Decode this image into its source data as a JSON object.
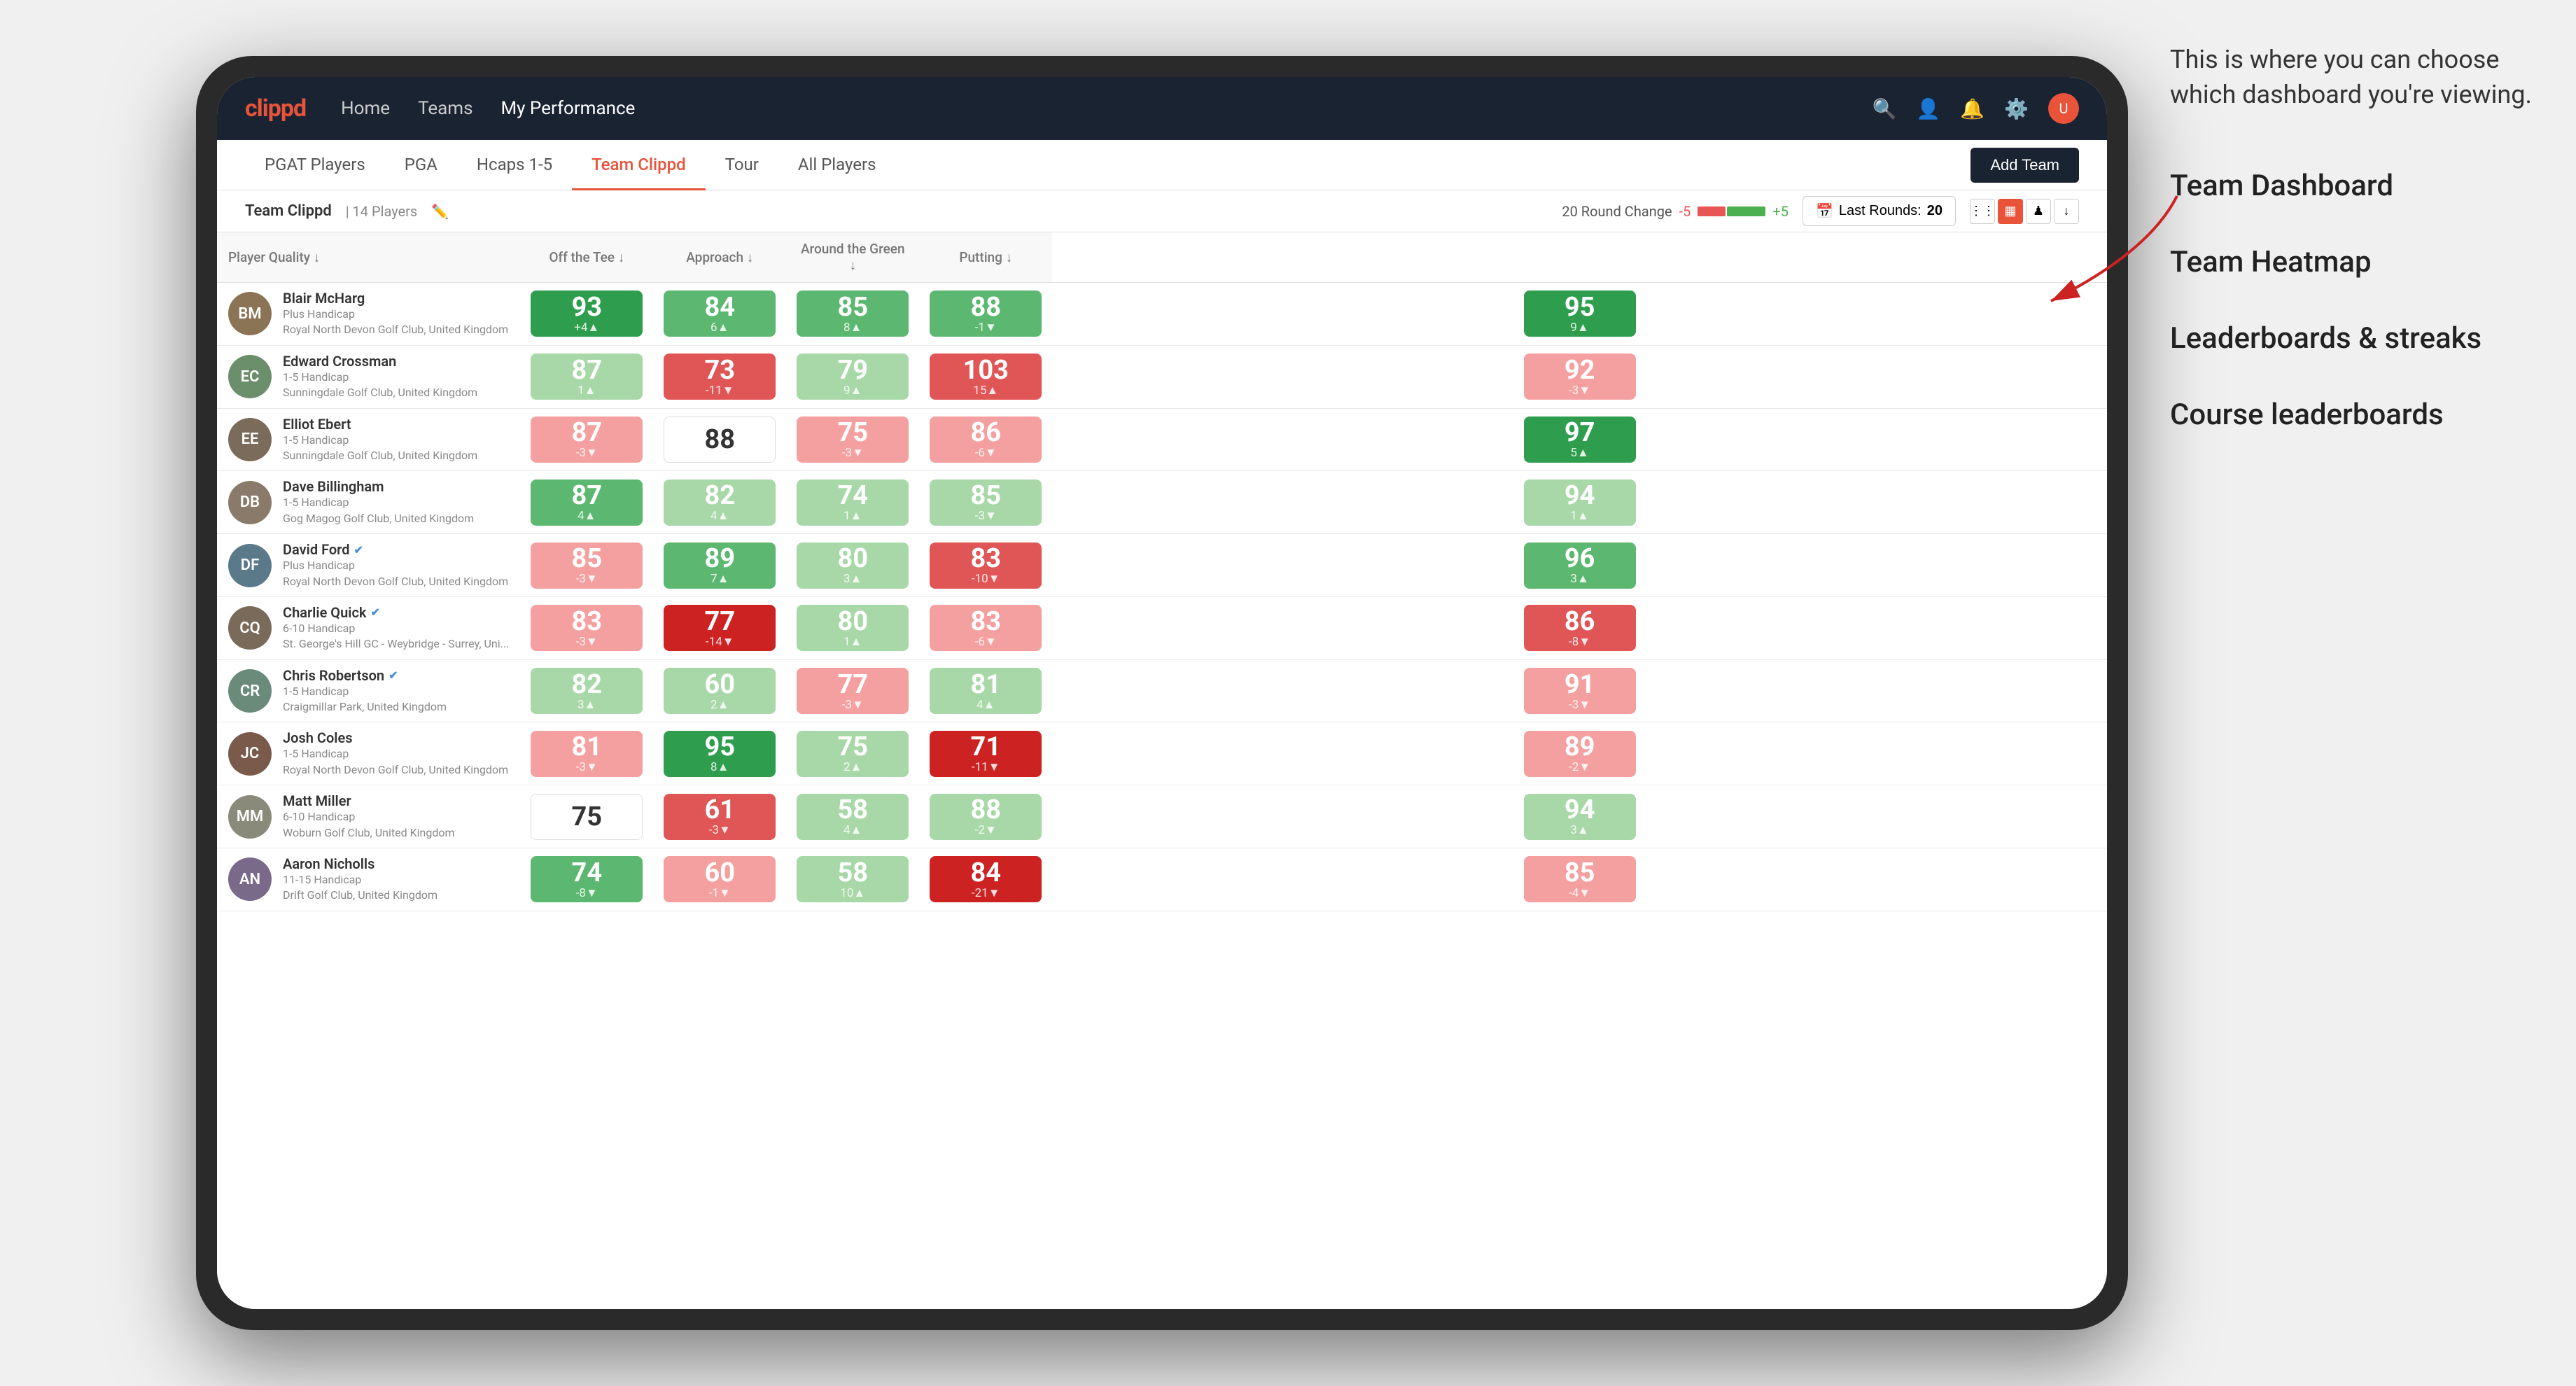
{
  "annotation": {
    "callout": "This is where you can choose which dashboard you're viewing.",
    "items": [
      "Team Dashboard",
      "Team Heatmap",
      "Leaderboards & streaks",
      "Course leaderboards"
    ]
  },
  "nav": {
    "logo": "clippd",
    "items": [
      "Home",
      "Teams",
      "My Performance"
    ],
    "active_item": "My Performance"
  },
  "tabs": {
    "items": [
      "PGAT Players",
      "PGA",
      "Hcaps 1-5",
      "Team Clippd",
      "Tour",
      "All Players"
    ],
    "active": "Team Clippd",
    "add_team_label": "Add Team"
  },
  "sub_header": {
    "team_name": "Team Clippd",
    "separator": "|",
    "player_count": "14 Players",
    "round_change_label": "20 Round Change",
    "change_neg": "-5",
    "change_pos": "+5",
    "last_rounds_label": "Last Rounds:",
    "last_rounds_value": "20"
  },
  "table": {
    "columns": [
      "Player Quality ↓",
      "Off the Tee ↓",
      "Approach ↓",
      "Around the Green ↓",
      "Putting ↓"
    ],
    "rows": [
      {
        "name": "Blair McHarg",
        "handicap": "Plus Handicap",
        "club": "Royal North Devon Golf Club, United Kingdom",
        "initials": "BM",
        "avatar_color": "#8B7355",
        "scores": [
          {
            "value": 93,
            "delta": "+4",
            "dir": "up",
            "bg": "green-dark"
          },
          {
            "value": 84,
            "delta": "6",
            "dir": "up",
            "bg": "green-mid"
          },
          {
            "value": 85,
            "delta": "8",
            "dir": "up",
            "bg": "green-mid"
          },
          {
            "value": 88,
            "delta": "-1",
            "dir": "down",
            "bg": "green-mid"
          },
          {
            "value": 95,
            "delta": "9",
            "dir": "up",
            "bg": "green-dark"
          }
        ]
      },
      {
        "name": "Edward Crossman",
        "handicap": "1-5 Handicap",
        "club": "Sunningdale Golf Club, United Kingdom",
        "initials": "EC",
        "avatar_color": "#6B8E6B",
        "scores": [
          {
            "value": 87,
            "delta": "1",
            "dir": "up",
            "bg": "green-light"
          },
          {
            "value": 73,
            "delta": "-11",
            "dir": "down",
            "bg": "red-mid"
          },
          {
            "value": 79,
            "delta": "9",
            "dir": "up",
            "bg": "green-light"
          },
          {
            "value": 103,
            "delta": "15",
            "dir": "up",
            "bg": "red-mid"
          },
          {
            "value": 92,
            "delta": "-3",
            "dir": "down",
            "bg": "red-light"
          }
        ]
      },
      {
        "name": "Elliot Ebert",
        "handicap": "1-5 Handicap",
        "club": "Sunningdale Golf Club, United Kingdom",
        "initials": "EE",
        "avatar_color": "#7B6B5A",
        "scores": [
          {
            "value": 87,
            "delta": "-3",
            "dir": "down",
            "bg": "red-light"
          },
          {
            "value": 88,
            "delta": "",
            "dir": "none",
            "bg": "white"
          },
          {
            "value": 75,
            "delta": "-3",
            "dir": "down",
            "bg": "red-light"
          },
          {
            "value": 86,
            "delta": "-6",
            "dir": "down",
            "bg": "red-light"
          },
          {
            "value": 97,
            "delta": "5",
            "dir": "up",
            "bg": "green-dark"
          }
        ]
      },
      {
        "name": "Dave Billingham",
        "handicap": "1-5 Handicap",
        "club": "Gog Magog Golf Club, United Kingdom",
        "initials": "DB",
        "avatar_color": "#8A7A6A",
        "scores": [
          {
            "value": 87,
            "delta": "4",
            "dir": "up",
            "bg": "green-mid"
          },
          {
            "value": 82,
            "delta": "4",
            "dir": "up",
            "bg": "green-light"
          },
          {
            "value": 74,
            "delta": "1",
            "dir": "up",
            "bg": "green-light"
          },
          {
            "value": 85,
            "delta": "-3",
            "dir": "down",
            "bg": "green-light"
          },
          {
            "value": 94,
            "delta": "1",
            "dir": "up",
            "bg": "green-light"
          }
        ]
      },
      {
        "name": "David Ford",
        "handicap": "Plus Handicap",
        "club": "Royal North Devon Golf Club, United Kingdom",
        "initials": "DF",
        "avatar_color": "#5A7A8A",
        "verified": true,
        "scores": [
          {
            "value": 85,
            "delta": "-3",
            "dir": "down",
            "bg": "red-light"
          },
          {
            "value": 89,
            "delta": "7",
            "dir": "up",
            "bg": "green-mid"
          },
          {
            "value": 80,
            "delta": "3",
            "dir": "up",
            "bg": "green-light"
          },
          {
            "value": 83,
            "delta": "-10",
            "dir": "down",
            "bg": "red-mid"
          },
          {
            "value": 96,
            "delta": "3",
            "dir": "up",
            "bg": "green-mid"
          }
        ]
      },
      {
        "name": "Charlie Quick",
        "handicap": "6-10 Handicap",
        "club": "St. George's Hill GC - Weybridge - Surrey, Uni...",
        "initials": "CQ",
        "avatar_color": "#7A6A5A",
        "verified": true,
        "scores": [
          {
            "value": 83,
            "delta": "-3",
            "dir": "down",
            "bg": "red-light"
          },
          {
            "value": 77,
            "delta": "-14",
            "dir": "down",
            "bg": "red-dark"
          },
          {
            "value": 80,
            "delta": "1",
            "dir": "up",
            "bg": "green-light"
          },
          {
            "value": 83,
            "delta": "-6",
            "dir": "down",
            "bg": "red-light"
          },
          {
            "value": 86,
            "delta": "-8",
            "dir": "down",
            "bg": "red-mid"
          }
        ]
      },
      {
        "name": "Chris Robertson",
        "handicap": "1-5 Handicap",
        "club": "Craigmillar Park, United Kingdom",
        "initials": "CR",
        "avatar_color": "#6A8A7A",
        "verified": true,
        "scores": [
          {
            "value": 82,
            "delta": "3",
            "dir": "up",
            "bg": "green-light"
          },
          {
            "value": 60,
            "delta": "2",
            "dir": "up",
            "bg": "green-light"
          },
          {
            "value": 77,
            "delta": "-3",
            "dir": "down",
            "bg": "red-light"
          },
          {
            "value": 81,
            "delta": "4",
            "dir": "up",
            "bg": "green-light"
          },
          {
            "value": 91,
            "delta": "-3",
            "dir": "down",
            "bg": "red-light"
          }
        ]
      },
      {
        "name": "Josh Coles",
        "handicap": "1-5 Handicap",
        "club": "Royal North Devon Golf Club, United Kingdom",
        "initials": "JC",
        "avatar_color": "#7A5A4A",
        "scores": [
          {
            "value": 81,
            "delta": "-3",
            "dir": "down",
            "bg": "red-light"
          },
          {
            "value": 95,
            "delta": "8",
            "dir": "up",
            "bg": "green-dark"
          },
          {
            "value": 75,
            "delta": "2",
            "dir": "up",
            "bg": "green-light"
          },
          {
            "value": 71,
            "delta": "-11",
            "dir": "down",
            "bg": "red-dark"
          },
          {
            "value": 89,
            "delta": "-2",
            "dir": "down",
            "bg": "red-light"
          }
        ]
      },
      {
        "name": "Matt Miller",
        "handicap": "6-10 Handicap",
        "club": "Woburn Golf Club, United Kingdom",
        "initials": "MM",
        "avatar_color": "#8A8A7A",
        "scores": [
          {
            "value": 75,
            "delta": "",
            "dir": "none",
            "bg": "white"
          },
          {
            "value": 61,
            "delta": "-3",
            "dir": "down",
            "bg": "red-mid"
          },
          {
            "value": 58,
            "delta": "4",
            "dir": "up",
            "bg": "green-light"
          },
          {
            "value": 88,
            "delta": "-2",
            "dir": "down",
            "bg": "green-light"
          },
          {
            "value": 94,
            "delta": "3",
            "dir": "up",
            "bg": "green-light"
          }
        ]
      },
      {
        "name": "Aaron Nicholls",
        "handicap": "11-15 Handicap",
        "club": "Drift Golf Club, United Kingdom",
        "initials": "AN",
        "avatar_color": "#7A6A8A",
        "scores": [
          {
            "value": 74,
            "delta": "-8",
            "dir": "down",
            "bg": "green-mid"
          },
          {
            "value": 60,
            "delta": "-1",
            "dir": "down",
            "bg": "red-light"
          },
          {
            "value": 58,
            "delta": "10",
            "dir": "up",
            "bg": "green-light"
          },
          {
            "value": 84,
            "delta": "-21",
            "dir": "down",
            "bg": "red-dark"
          },
          {
            "value": 85,
            "delta": "-4",
            "dir": "down",
            "bg": "red-light"
          }
        ]
      }
    ]
  }
}
